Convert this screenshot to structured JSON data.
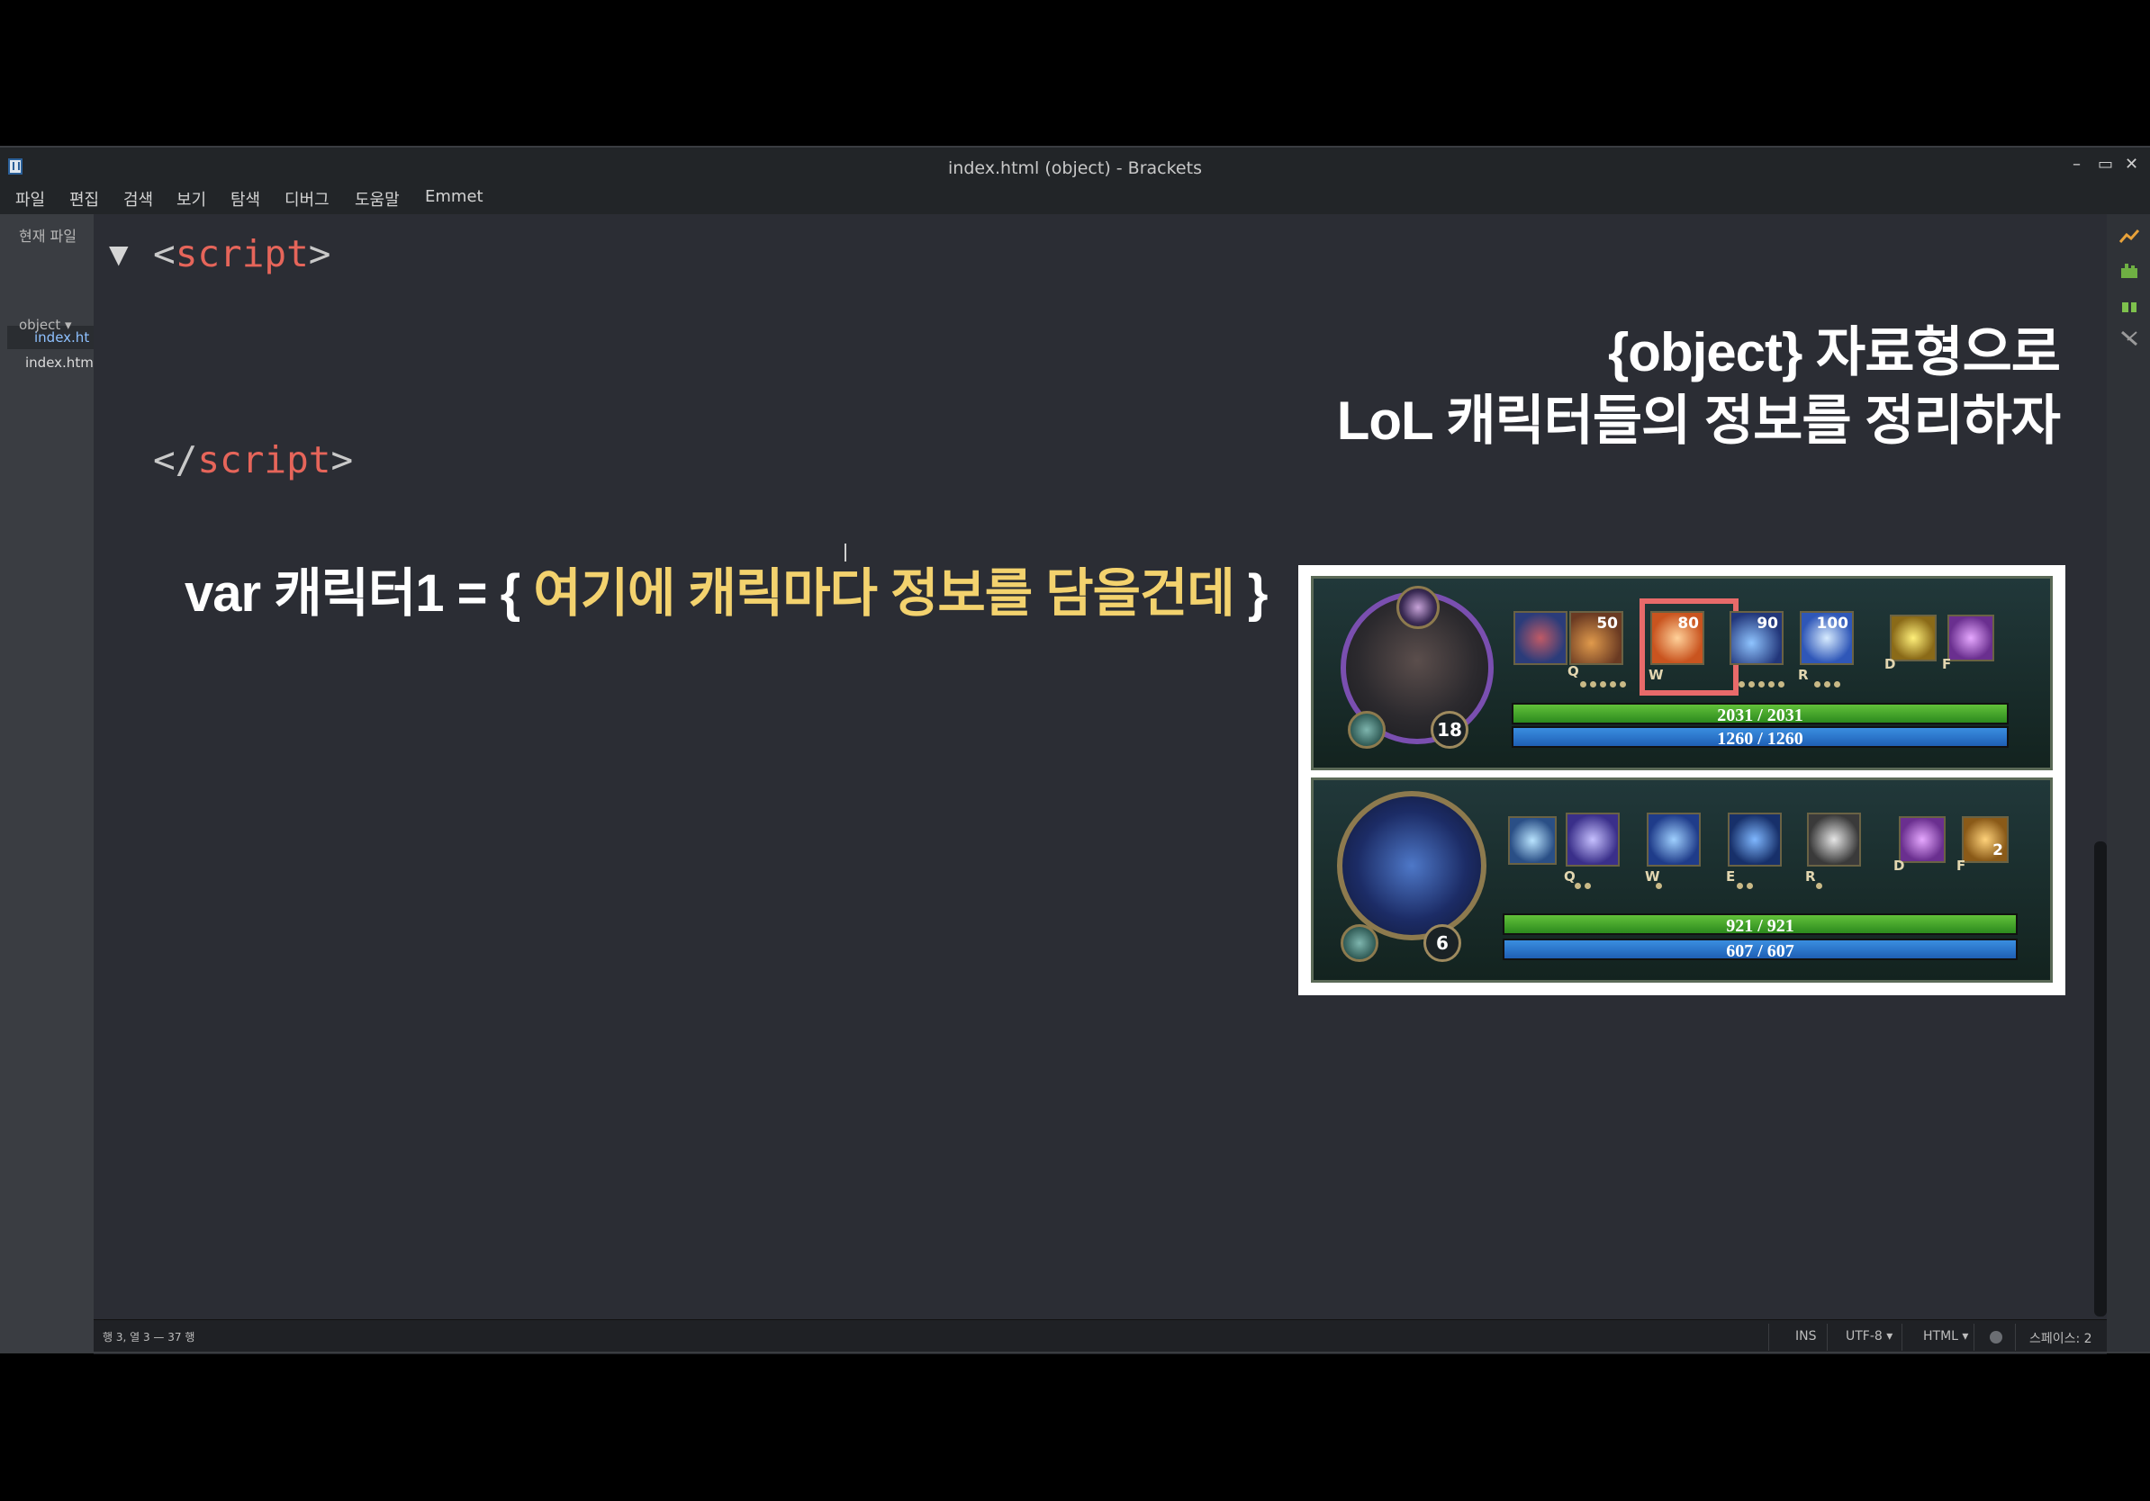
{
  "window": {
    "title": "index.html (object) - Brackets",
    "controls": {
      "minimize": "–",
      "maximize": "▭",
      "close": "✕"
    }
  },
  "menu": [
    "파일",
    "편집",
    "검색",
    "보기",
    "탐색",
    "디버그",
    "도움말",
    "Emmet"
  ],
  "sidebar": {
    "working_files_label": "현재 파일",
    "working_file": "index.ht",
    "project_label": "object ▾",
    "project_file": "index.html"
  },
  "editor": {
    "fold_marker": "▼",
    "line1_open": "<",
    "line1_tag": "script",
    "line1_close": ">",
    "line2_open": "</",
    "line2_tag": "script",
    "line2_close": ">"
  },
  "overlay": {
    "title_line1": "{object} 자료형으로",
    "title_line2": "LoL 캐릭터들의 정보를 정리하자",
    "var_prefix": "var 캐릭터1 = { ",
    "var_body": "여기에 캐릭마다 정보를 담을건데",
    "var_suffix": " }"
  },
  "game_image": {
    "panel1": {
      "level": "18",
      "skill_levels": [
        "50",
        "80",
        "90",
        "100"
      ],
      "skill_keys": [
        "Q",
        "W",
        "R",
        "D",
        "F"
      ],
      "hp": "2031 / 2031",
      "mp": "1260 / 1260"
    },
    "panel2": {
      "level": "6",
      "skill_keys": [
        "Q",
        "W",
        "E",
        "R",
        "D",
        "F"
      ],
      "extra": "2",
      "hp": "921 / 921",
      "mp": "607 / 607"
    }
  },
  "statusbar": {
    "position": "행 3, 열 3 — 37 행",
    "mode": "INS",
    "encoding": "UTF-8 ▾",
    "language": "HTML ▾",
    "indent": "스페이스: 2"
  },
  "colors": {
    "editor_bg": "#2b2d34",
    "tag_color": "#e6655a",
    "highlight_yellow": "#f3d26e",
    "skill_highlight": "#e86a6a"
  }
}
